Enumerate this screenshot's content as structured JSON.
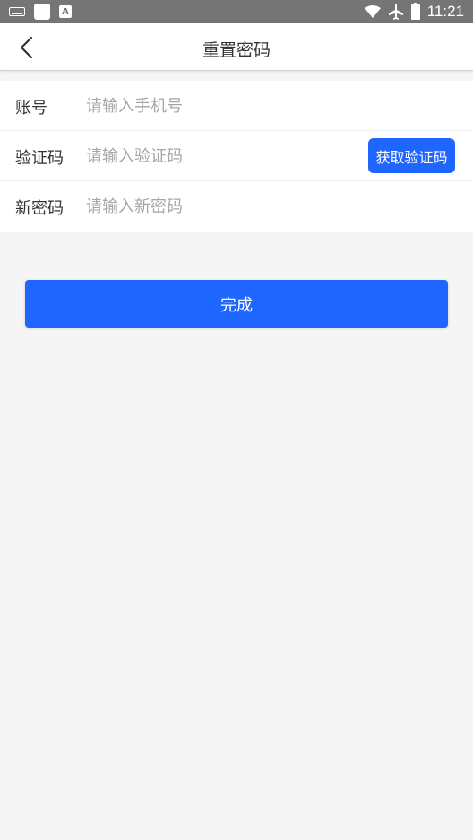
{
  "status_bar": {
    "time": "11:21",
    "left_icons": [
      "keyboard-icon",
      "notification-square-icon",
      "text-a-icon"
    ],
    "right_icons": [
      "wifi-icon",
      "airplane-icon",
      "battery-charging-icon"
    ]
  },
  "header": {
    "title": "重置密码",
    "back_icon": "chevron-left-icon"
  },
  "form": {
    "account": {
      "label": "账号",
      "placeholder": "请输入手机号",
      "value": ""
    },
    "code": {
      "label": "验证码",
      "placeholder": "请输入验证码",
      "value": "",
      "button_label": "获取验证码"
    },
    "new_password": {
      "label": "新密码",
      "placeholder": "请输入新密码",
      "value": ""
    }
  },
  "submit": {
    "label": "完成"
  },
  "colors": {
    "primary": "#1f66ff",
    "background": "#f5f5f5",
    "status_bar": "#757575",
    "text": "#333333",
    "placeholder": "#a6a6a6"
  }
}
